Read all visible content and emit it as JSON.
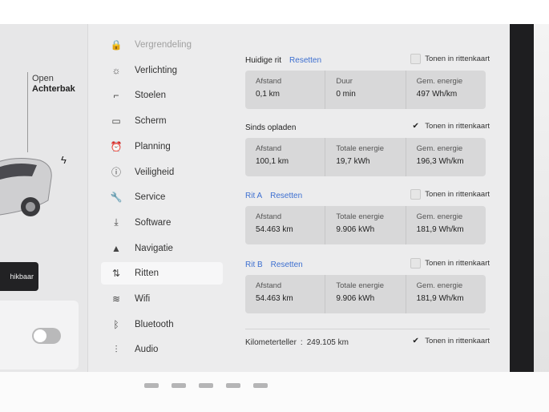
{
  "car_panel": {
    "trunk_label": "Open",
    "trunk_value": "Achterbak",
    "available_button": "hikbaar"
  },
  "sidebar": {
    "items": [
      {
        "label": "Vergrendeling",
        "icon": "lock-icon",
        "glyph": "🔒"
      },
      {
        "label": "Verlichting",
        "icon": "light-icon",
        "glyph": "☼"
      },
      {
        "label": "Stoelen",
        "icon": "seat-icon",
        "glyph": "⌐"
      },
      {
        "label": "Scherm",
        "icon": "display-icon",
        "glyph": "▭"
      },
      {
        "label": "Planning",
        "icon": "alarm-clock-icon",
        "glyph": "⏰"
      },
      {
        "label": "Veiligheid",
        "icon": "safety-icon",
        "glyph": "ⓘ"
      },
      {
        "label": "Service",
        "icon": "wrench-icon",
        "glyph": "🔧"
      },
      {
        "label": "Software",
        "icon": "download-icon",
        "glyph": "⤓"
      },
      {
        "label": "Navigatie",
        "icon": "navigation-icon",
        "glyph": "▲"
      },
      {
        "label": "Ritten",
        "icon": "trips-icon",
        "glyph": "⇅"
      },
      {
        "label": "Wifi",
        "icon": "wifi-icon",
        "glyph": "≋"
      },
      {
        "label": "Bluetooth",
        "icon": "bluetooth-icon",
        "glyph": "ᛒ"
      },
      {
        "label": "Audio",
        "icon": "audio-icon",
        "glyph": "⫶"
      }
    ],
    "active_index": 9
  },
  "sections": {
    "current_trip": {
      "title": "Huidige rit",
      "reset": "Resetten",
      "show_label": "Tonen in rittenkaart",
      "checked": false,
      "cells": [
        {
          "label": "Afstand",
          "value": "0,1 km"
        },
        {
          "label": "Duur",
          "value": "0 min"
        },
        {
          "label": "Gem. energie",
          "value": "497 Wh/km"
        }
      ]
    },
    "since_charge": {
      "title": "Sinds opladen",
      "show_label": "Tonen in rittenkaart",
      "checked": true,
      "cells": [
        {
          "label": "Afstand",
          "value": "100,1 km"
        },
        {
          "label": "Totale energie",
          "value": "19,7 kWh"
        },
        {
          "label": "Gem. energie",
          "value": "196,3 Wh/km"
        }
      ]
    },
    "trip_a": {
      "title": "Rit A",
      "reset": "Resetten",
      "show_label": "Tonen in rittenkaart",
      "checked": false,
      "cells": [
        {
          "label": "Afstand",
          "value": "54.463 km"
        },
        {
          "label": "Totale energie",
          "value": "9.906 kWh"
        },
        {
          "label": "Gem. energie",
          "value": "181,9 Wh/km"
        }
      ]
    },
    "trip_b": {
      "title": "Rit B",
      "reset": "Resetten",
      "show_label": "Tonen in rittenkaart",
      "checked": false,
      "cells": [
        {
          "label": "Afstand",
          "value": "54.463 km"
        },
        {
          "label": "Totale energie",
          "value": "9.906 kWh"
        },
        {
          "label": "Gem. energie",
          "value": "181,9 Wh/km"
        }
      ]
    }
  },
  "odometer": {
    "label": "Kilometerteller",
    "separator": ":",
    "value": "249.105 km",
    "show_label": "Tonen in rittenkaart",
    "checked": true
  }
}
